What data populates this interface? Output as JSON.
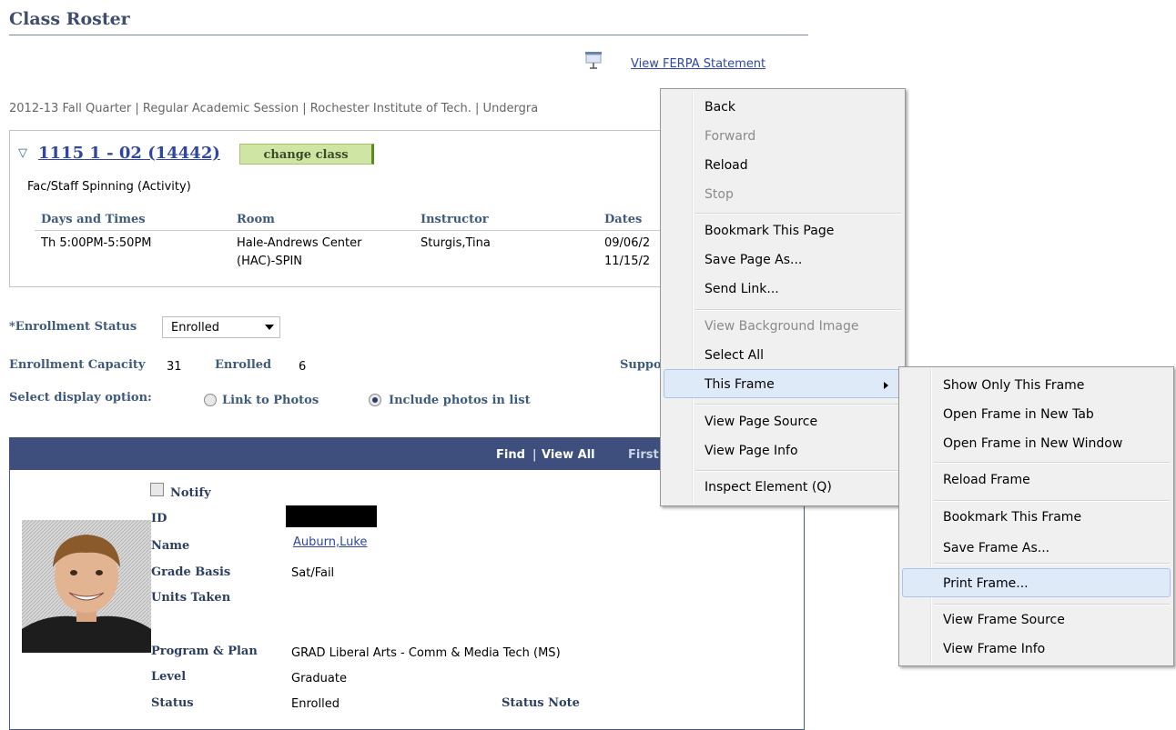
{
  "page": {
    "title": "Class Roster",
    "ferpa_link": "View FERPA Statement",
    "session_line": "2012-13 Fall Quarter | Regular Academic Session | Rochester Institute of Tech. | Undergra"
  },
  "class_info": {
    "class_link": "1115 1 - 02 (14442)",
    "change_button": "change class",
    "course_name": "Fac/Staff Spinning (Activity)",
    "headers": [
      "Days and Times",
      "Room",
      "Instructor",
      "Dates"
    ],
    "row": {
      "days_times": "Th 5:00PM-5:50PM",
      "room_line1": "Hale-Andrews Center",
      "room_line2": "(HAC)-SPIN",
      "instructor": "Sturgis,Tina",
      "dates_line1": "09/06/2",
      "dates_line2": "11/15/2"
    }
  },
  "enrollment": {
    "status_label": "*Enrollment Status",
    "status_value": "Enrolled",
    "capacity_label": "Enrollment Capacity",
    "capacity_value": "31",
    "enrolled_label": "Enrolled",
    "enrolled_value": "6",
    "support_label": "Suppo",
    "display_label": "Select display option:",
    "option_link_photos": "Link to Photos",
    "option_include_photos": "Include photos in list",
    "selected_option": "Include photos in list"
  },
  "grid": {
    "find": "Find",
    "divider": "|",
    "view_all": "View All",
    "first": "First"
  },
  "student": {
    "notify_label": "Notify",
    "id_label": "ID",
    "name_label": "Name",
    "name_value": "Auburn,Luke",
    "grade_basis_label": "Grade Basis",
    "grade_basis_value": "Sat/Fail",
    "units_label": "Units Taken",
    "program_label": "Program & Plan",
    "program_value": "GRAD Liberal Arts - Comm & Media Tech (MS)",
    "level_label": "Level",
    "level_value": "Graduate",
    "status_label": "Status",
    "status_value": "Enrolled",
    "status_note_label": "Status Note"
  },
  "context_menu": {
    "back": "Back",
    "forward": "Forward",
    "reload": "Reload",
    "stop": "Stop",
    "bookmark_page": "Bookmark This Page",
    "save_page_as": "Save Page As...",
    "send_link": "Send Link...",
    "view_background_image": "View Background Image",
    "select_all": "Select All",
    "this_frame": "This Frame",
    "view_page_source": "View Page Source",
    "view_page_info": "View Page Info",
    "inspect_element": "Inspect Element (Q)"
  },
  "submenu": {
    "show_only_this_frame": "Show Only This Frame",
    "open_frame_new_tab": "Open Frame in New Tab",
    "open_frame_new_window": "Open Frame in New Window",
    "reload_frame": "Reload Frame",
    "bookmark_this_frame": "Bookmark This Frame",
    "save_frame_as": "Save Frame As...",
    "print_frame": "Print Frame...",
    "view_frame_source": "View Frame Source",
    "view_frame_info": "View Frame Info"
  },
  "icons": {
    "ferpa": "projection-screen-icon",
    "expand": "triangle-down-icon",
    "dropdown": "chevron-down-icon",
    "submenu": "arrow-right-icon"
  },
  "colors": {
    "title": "#3e4c6d",
    "link": "#2f46a3",
    "grid_header": "#3e4f7e",
    "change_button": "#cfe5a3",
    "menu_bg": "#f0f0f0",
    "menu_highlight": "#dfeaf8"
  }
}
